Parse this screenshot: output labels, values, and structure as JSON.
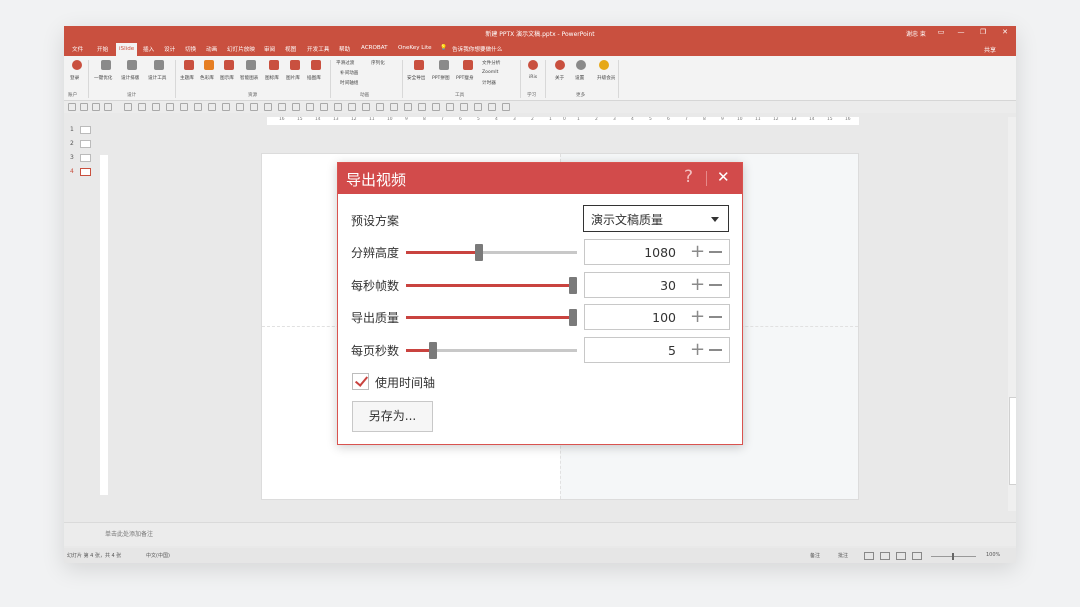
{
  "app": {
    "title": "新建 PPTX 演示文稿.pptx - PowerPoint",
    "user": "谢忠 束",
    "window_controls": [
      "▭",
      "—",
      "❐",
      "✕"
    ]
  },
  "menu": {
    "tabs": [
      "文件",
      "开始",
      "iSlide",
      "插入",
      "设计",
      "切换",
      "动画",
      "幻灯片放映",
      "审阅",
      "视图",
      "开发工具",
      "帮助",
      "ACROBAT",
      "OneKey Lite"
    ],
    "active": "iSlide",
    "tell_me": "告诉我你想要做什么",
    "share": "共享"
  },
  "ribbon": {
    "items": [
      {
        "label": "登录",
        "color": "#c9503f"
      },
      {
        "label": "一键优化",
        "color": "#777"
      },
      {
        "label": "设计排版",
        "color": "#777"
      },
      {
        "label": "设计工具",
        "color": "#777"
      },
      {
        "label": "主题库",
        "color": "#c9503f"
      },
      {
        "label": "色彩库",
        "color": "#e67e22"
      },
      {
        "label": "图示库",
        "color": "#c9503f"
      },
      {
        "label": "智能图表",
        "color": "#777"
      },
      {
        "label": "图标库",
        "color": "#c9503f"
      },
      {
        "label": "图片库",
        "color": "#c9503f"
      },
      {
        "label": "插图库",
        "color": "#c9503f"
      },
      {
        "label": "安全导出",
        "color": "#c9503f"
      },
      {
        "label": "PPT拼图",
        "color": "#777"
      },
      {
        "label": "PPT瘦身",
        "color": "#c9503f"
      },
      {
        "label": "iRis",
        "color": "#c9503f"
      },
      {
        "label": "关于",
        "color": "#c9503f"
      },
      {
        "label": "设置",
        "color": "#777"
      },
      {
        "label": "升级会员",
        "color": "#e6a817"
      }
    ],
    "small_items": [
      "平滑过渡",
      "序列化",
      "补间动画",
      "时间轴组",
      "文件分析",
      "ZoomIt",
      "计时器"
    ],
    "groups": [
      "账户",
      "设计",
      "资源",
      "动画",
      "工具",
      "学习",
      "更多"
    ]
  },
  "ruler": {
    "ticks": [
      "16",
      "15",
      "14",
      "13",
      "12",
      "11",
      "10",
      "9",
      "8",
      "7",
      "6",
      "5",
      "4",
      "3",
      "2",
      "1",
      "0",
      "1",
      "2",
      "3",
      "4",
      "5",
      "6",
      "7",
      "8",
      "9",
      "10",
      "11",
      "12",
      "13",
      "14",
      "15",
      "16"
    ]
  },
  "thumbnails": [
    "1",
    "2",
    "3",
    "4"
  ],
  "notes_placeholder": "单击此处添加备注",
  "statusbar": {
    "slide_info": "幻灯片 第 4 张，共 4 张",
    "language": "中文(中国)",
    "notes": "备注",
    "comments": "批注",
    "zoom": "100%"
  },
  "dialog": {
    "title": "导出视频",
    "help": "?",
    "close": "✕",
    "preset_label": "预设方案",
    "preset_value": "演示文稿质量",
    "rows": [
      {
        "label": "分辨高度",
        "value": "1080",
        "level": 0.43
      },
      {
        "label": "每秒帧数",
        "value": "30",
        "level": 1.0
      },
      {
        "label": "导出质量",
        "value": "100",
        "level": 1.0
      },
      {
        "label": "每页秒数",
        "value": "5",
        "level": 0.15
      }
    ],
    "plus": "+",
    "timeline_label": "使用时间轴",
    "timeline_checked": true,
    "save_as": "另存为..."
  }
}
